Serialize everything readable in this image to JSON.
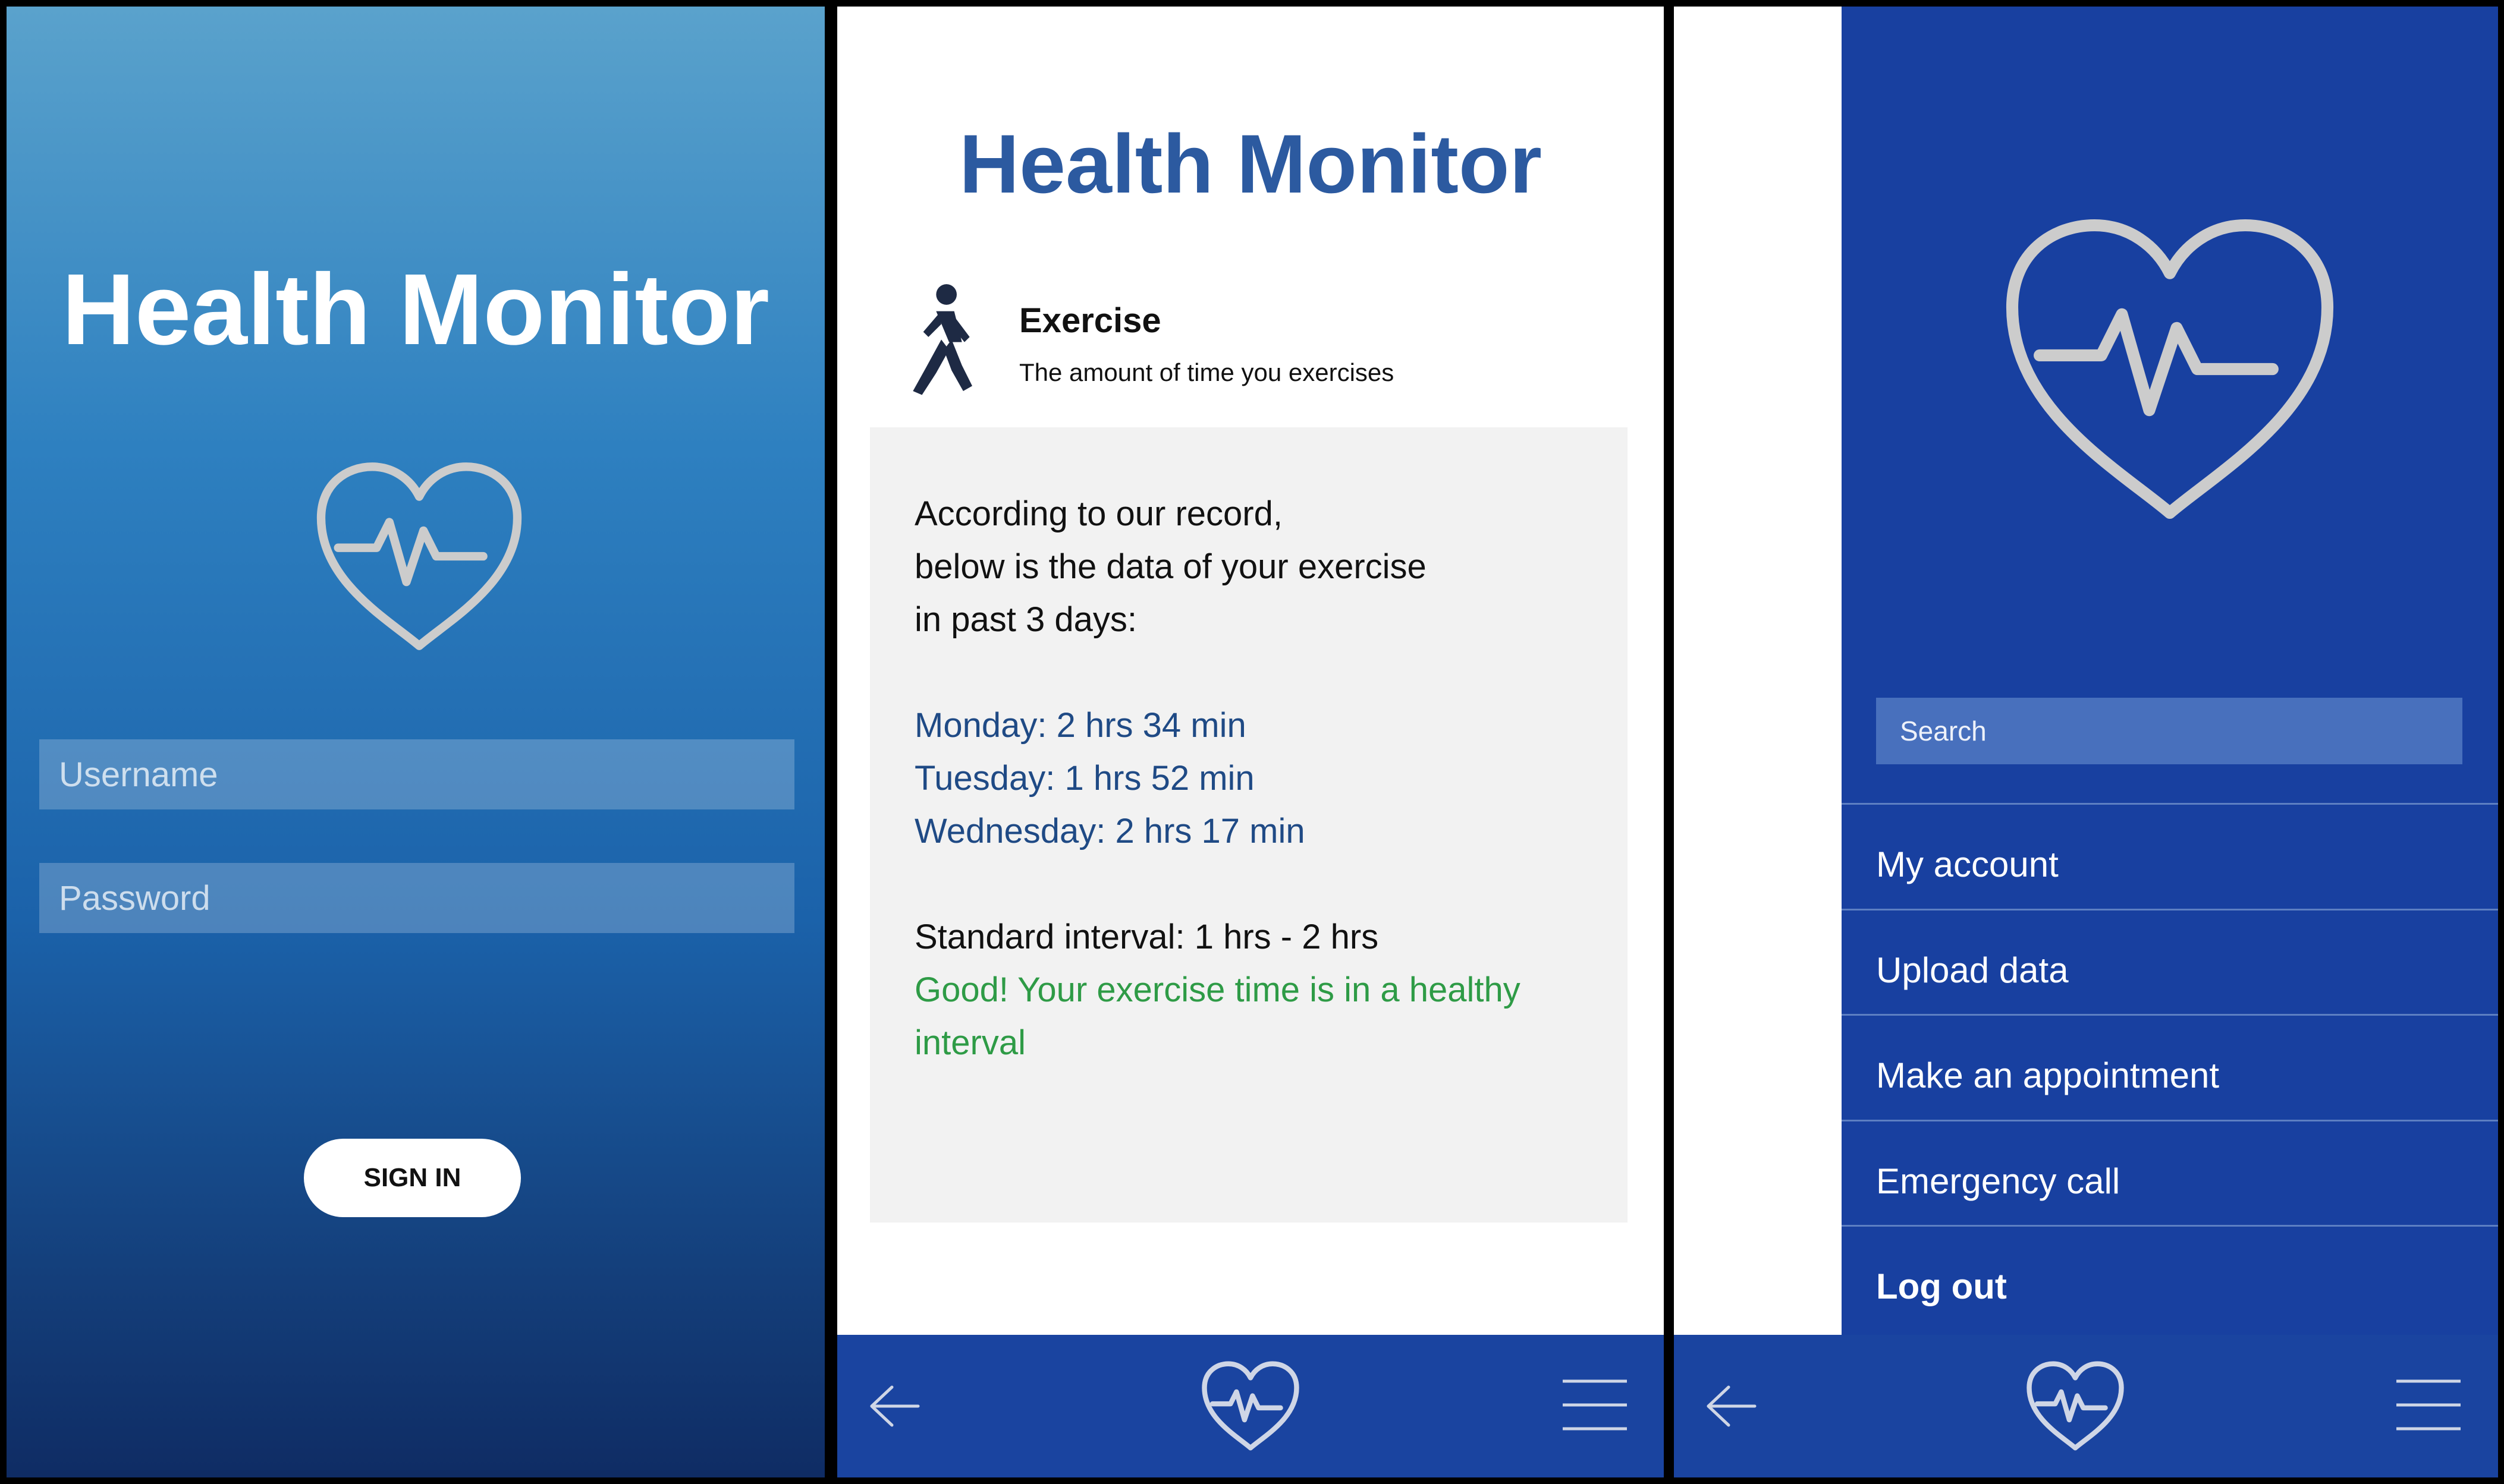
{
  "screen_login": {
    "title": "Health Monitor",
    "username_placeholder": "Username",
    "password_placeholder": "Password",
    "signin_label": "SIGN IN",
    "logo_icon": "heart-pulse-icon"
  },
  "screen_exercise": {
    "title": "Health Monitor",
    "exercise_icon": "walking-person-icon",
    "section_title": "Exercise",
    "section_subtitle": "The amount of time you exercises",
    "intro_lines": [
      "According to our record,",
      "below is the data of your exercise",
      "in past 3 days:"
    ],
    "days": [
      "Monday: 2 hrs 34 min",
      "Tuesday: 1 hrs 52 min",
      "Wednesday:  2 hrs 17 min"
    ],
    "standard_interval": "Standard interval: 1 hrs - 2 hrs",
    "verdict_lines": [
      "Good! Your exercise time is in a healthy",
      "interval"
    ]
  },
  "screen_menu": {
    "search_placeholder": "Search",
    "menu_items": [
      "My account",
      "Upload data",
      "Make an appointment",
      "Emergency call",
      "Log out"
    ]
  },
  "navbar": {
    "back_icon": "arrow-left-icon",
    "home_icon": "heart-pulse-icon",
    "menu_icon": "hamburger-menu-icon"
  },
  "colors": {
    "accent_blue": "#1a44a0",
    "title_blue": "#2c5aa0",
    "good_green": "#2e9b46",
    "heart_gray": "#cccccc"
  }
}
